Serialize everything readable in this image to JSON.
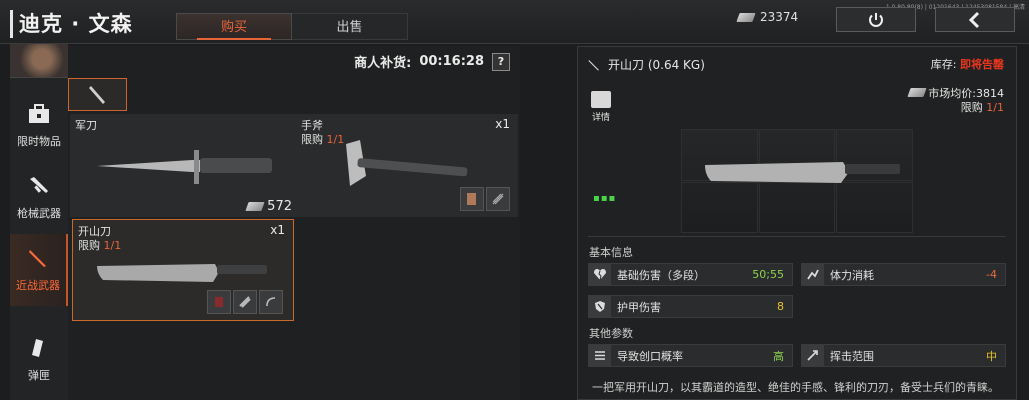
{
  "header": {
    "trader_name": "迪克 · 文森",
    "tabs": [
      {
        "label": "购买",
        "active": true
      },
      {
        "label": "出售",
        "active": false
      }
    ],
    "currency_amount": "23374",
    "version": "1.0.80.80(8) | 01201643 | 12453081584 | 高清"
  },
  "sidebar": {
    "items": [
      {
        "label": "限时物品",
        "icon": "briefcase-icon",
        "active": false
      },
      {
        "label": "枪械武器",
        "icon": "rifle-icon",
        "active": false
      },
      {
        "label": "近战武器",
        "icon": "machete-icon",
        "active": true
      },
      {
        "label": "弹匣",
        "icon": "magazine-icon",
        "active": false
      }
    ]
  },
  "shop": {
    "restock_label": "商人补货:",
    "restock_timer": "00:16:28",
    "help": "?",
    "items": [
      {
        "name": "军刀",
        "limit_label": "",
        "limit": "",
        "qty": "",
        "price": "572"
      },
      {
        "name": "手斧",
        "limit_label": "限购",
        "limit": "1/1",
        "qty": "x1",
        "price": ""
      },
      {
        "name": "开山刀",
        "limit_label": "限购",
        "limit": "1/1",
        "qty": "x1",
        "price": ""
      }
    ]
  },
  "detail": {
    "title": "开山刀 (0.64 KG)",
    "stock_label": "库存:",
    "stock_value": "即将告罄",
    "detail_label": "详情",
    "market_label": "市场均价:",
    "market_price": "3814",
    "limit_label": "限购",
    "limit_value": "1/1",
    "dots": "▪▪▪",
    "basic_info_label": "基本信息",
    "other_params_label": "其他参数",
    "stats": {
      "base_damage": {
        "label": "基础伤害（多段）",
        "value": "50;55"
      },
      "stamina": {
        "label": "体力消耗",
        "value": "-4"
      },
      "armor_damage": {
        "label": "护甲伤害",
        "value": "8"
      },
      "bleed": {
        "label": "导致创口概率",
        "value": "高"
      },
      "swing_range": {
        "label": "挥击范围",
        "value": "中"
      }
    },
    "description": "一把军用开山刀，以其霸道的造型、绝佳的手感、锋利的刀刃，备受士兵们的青睐。"
  },
  "colors": {
    "accent": "#e8653a",
    "stock_warning": "#e8361e",
    "good": "#8fd14f",
    "medium": "#e6c22a"
  }
}
